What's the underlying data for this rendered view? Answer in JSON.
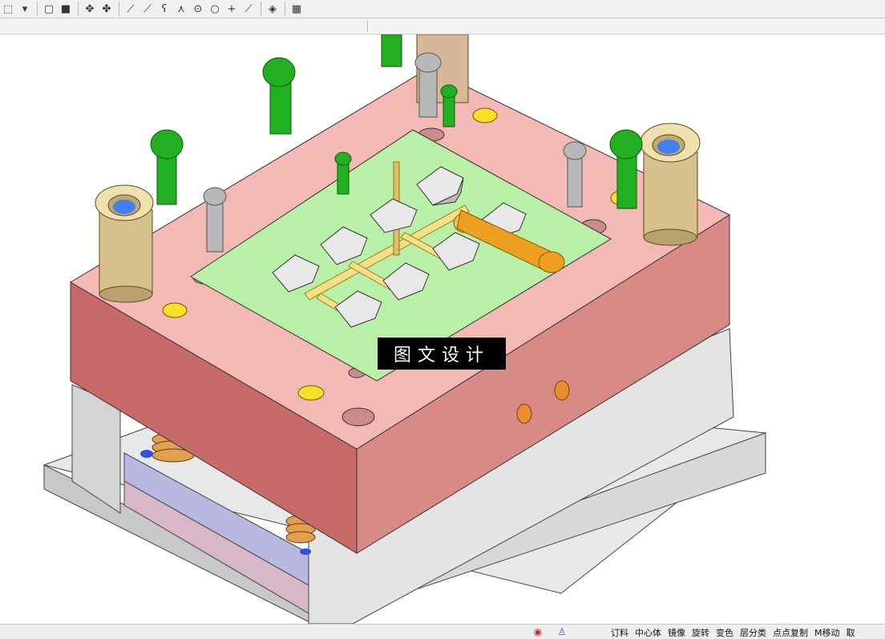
{
  "toolbar": {
    "buttons": [
      {
        "name": "select-box-icon",
        "glyph": "⬚"
      },
      {
        "name": "dropdown-arrow-icon",
        "glyph": "▾"
      },
      {
        "name": "sketch-box-icon",
        "glyph": "▢"
      },
      {
        "name": "solid-cube-icon",
        "glyph": "■"
      },
      {
        "name": "move-icon",
        "glyph": "✥"
      },
      {
        "name": "rotate-icon",
        "glyph": "✤"
      },
      {
        "name": "line-icon",
        "glyph": "⟋"
      },
      {
        "name": "line-point-icon",
        "glyph": "⟋"
      },
      {
        "name": "curve-icon",
        "glyph": "ʕ"
      },
      {
        "name": "split-icon",
        "glyph": "⋏"
      },
      {
        "name": "circle-center-icon",
        "glyph": "⊙"
      },
      {
        "name": "circle-icon",
        "glyph": "○"
      },
      {
        "name": "crosshair-icon",
        "glyph": "+"
      },
      {
        "name": "tangent-line-icon",
        "glyph": "⟋"
      },
      {
        "name": "view-icon",
        "glyph": "◈"
      },
      {
        "name": "grid-icon",
        "glyph": "▦"
      }
    ]
  },
  "viewport": {
    "watermark": "图文设计"
  },
  "statusbar": {
    "icons": [
      {
        "name": "color-wheel-icon",
        "glyph": "◉"
      },
      {
        "name": "flask-icon",
        "glyph": "♙"
      }
    ],
    "menu_items": [
      "订料",
      "中心体",
      "镜像",
      "旋转",
      "变色",
      "层分类",
      "点点复制",
      "M移动",
      "取"
    ]
  },
  "colors": {
    "plate_top": "#f4b9b5",
    "plate_side_left": "#c96a6a",
    "plate_side_right": "#d78a86",
    "insert": "#b8f0a8",
    "screw_green": "#22b022",
    "bushing": "#d6c08c",
    "runner": "#f5df88",
    "cylinder": "#f0a020"
  }
}
